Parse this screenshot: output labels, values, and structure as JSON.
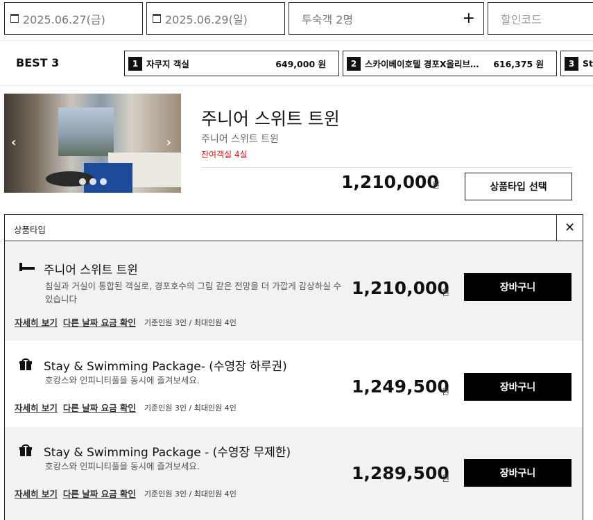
{
  "search": {
    "checkin": "2025.06.27(금)",
    "checkout": "2025.06.29(일)",
    "guests": "투숙객 2명",
    "guests_plus": "+",
    "promo_placeholder": "할인코드"
  },
  "best": {
    "title": "BEST 3",
    "items": [
      {
        "rank": "1",
        "name": "자쿠지 객실",
        "price": "649,000 원"
      },
      {
        "rank": "2",
        "name": "스카이베이호텔 경포X올리브…",
        "price": "616,375 원"
      },
      {
        "rank": "3",
        "name": "Sta",
        "price": ""
      }
    ]
  },
  "room": {
    "title": "주니어 스위트 트윈",
    "subtitle": "주니어 스위트 트윈",
    "remaining": "잔여객실 4실",
    "price": "1,210,000",
    "won": "원",
    "select_label": "상품타입 선택",
    "photo_prev": "‹",
    "photo_next": "›"
  },
  "panel": {
    "title": "상품타입",
    "close": "✕",
    "products": [
      {
        "icon": "bed-icon",
        "name": "주니어 스위트 트윈",
        "desc": "침실과 거실이 통합된 객실로, 경포호수의 그림 같은 전망을 더 가깝게 감상하실 수 있습니다",
        "price": "1,210,000",
        "won": "원",
        "cart": "장바구니",
        "link1": "자세히 보기",
        "link2": "다른 날짜 요금 확인",
        "capacity": "기준인원 3인 / 최대인원 4인"
      },
      {
        "icon": "gift-icon",
        "name": "Stay & Swimming Package- (수영장 하루권)",
        "desc": "호캉스와 인피니티풀을 동시에 즐겨보세요.",
        "price": "1,249,500",
        "won": "원",
        "cart": "장바구니",
        "link1": "자세히 보기",
        "link2": "다른 날짜 요금 확인",
        "capacity": "기준인원 3인 / 최대인원 4인"
      },
      {
        "icon": "gift-icon",
        "name": "Stay & Swimming Package - (수영장 무제한)",
        "desc": "호캉스와 인피니티풀을 동시에 즐겨보세요.",
        "price": "1,289,500",
        "won": "원",
        "cart": "장바구니",
        "link1": "자세히 보기",
        "link2": "다른 날짜 요금 확인",
        "capacity": "기준인원 3인 / 최대인원 4인"
      }
    ]
  }
}
